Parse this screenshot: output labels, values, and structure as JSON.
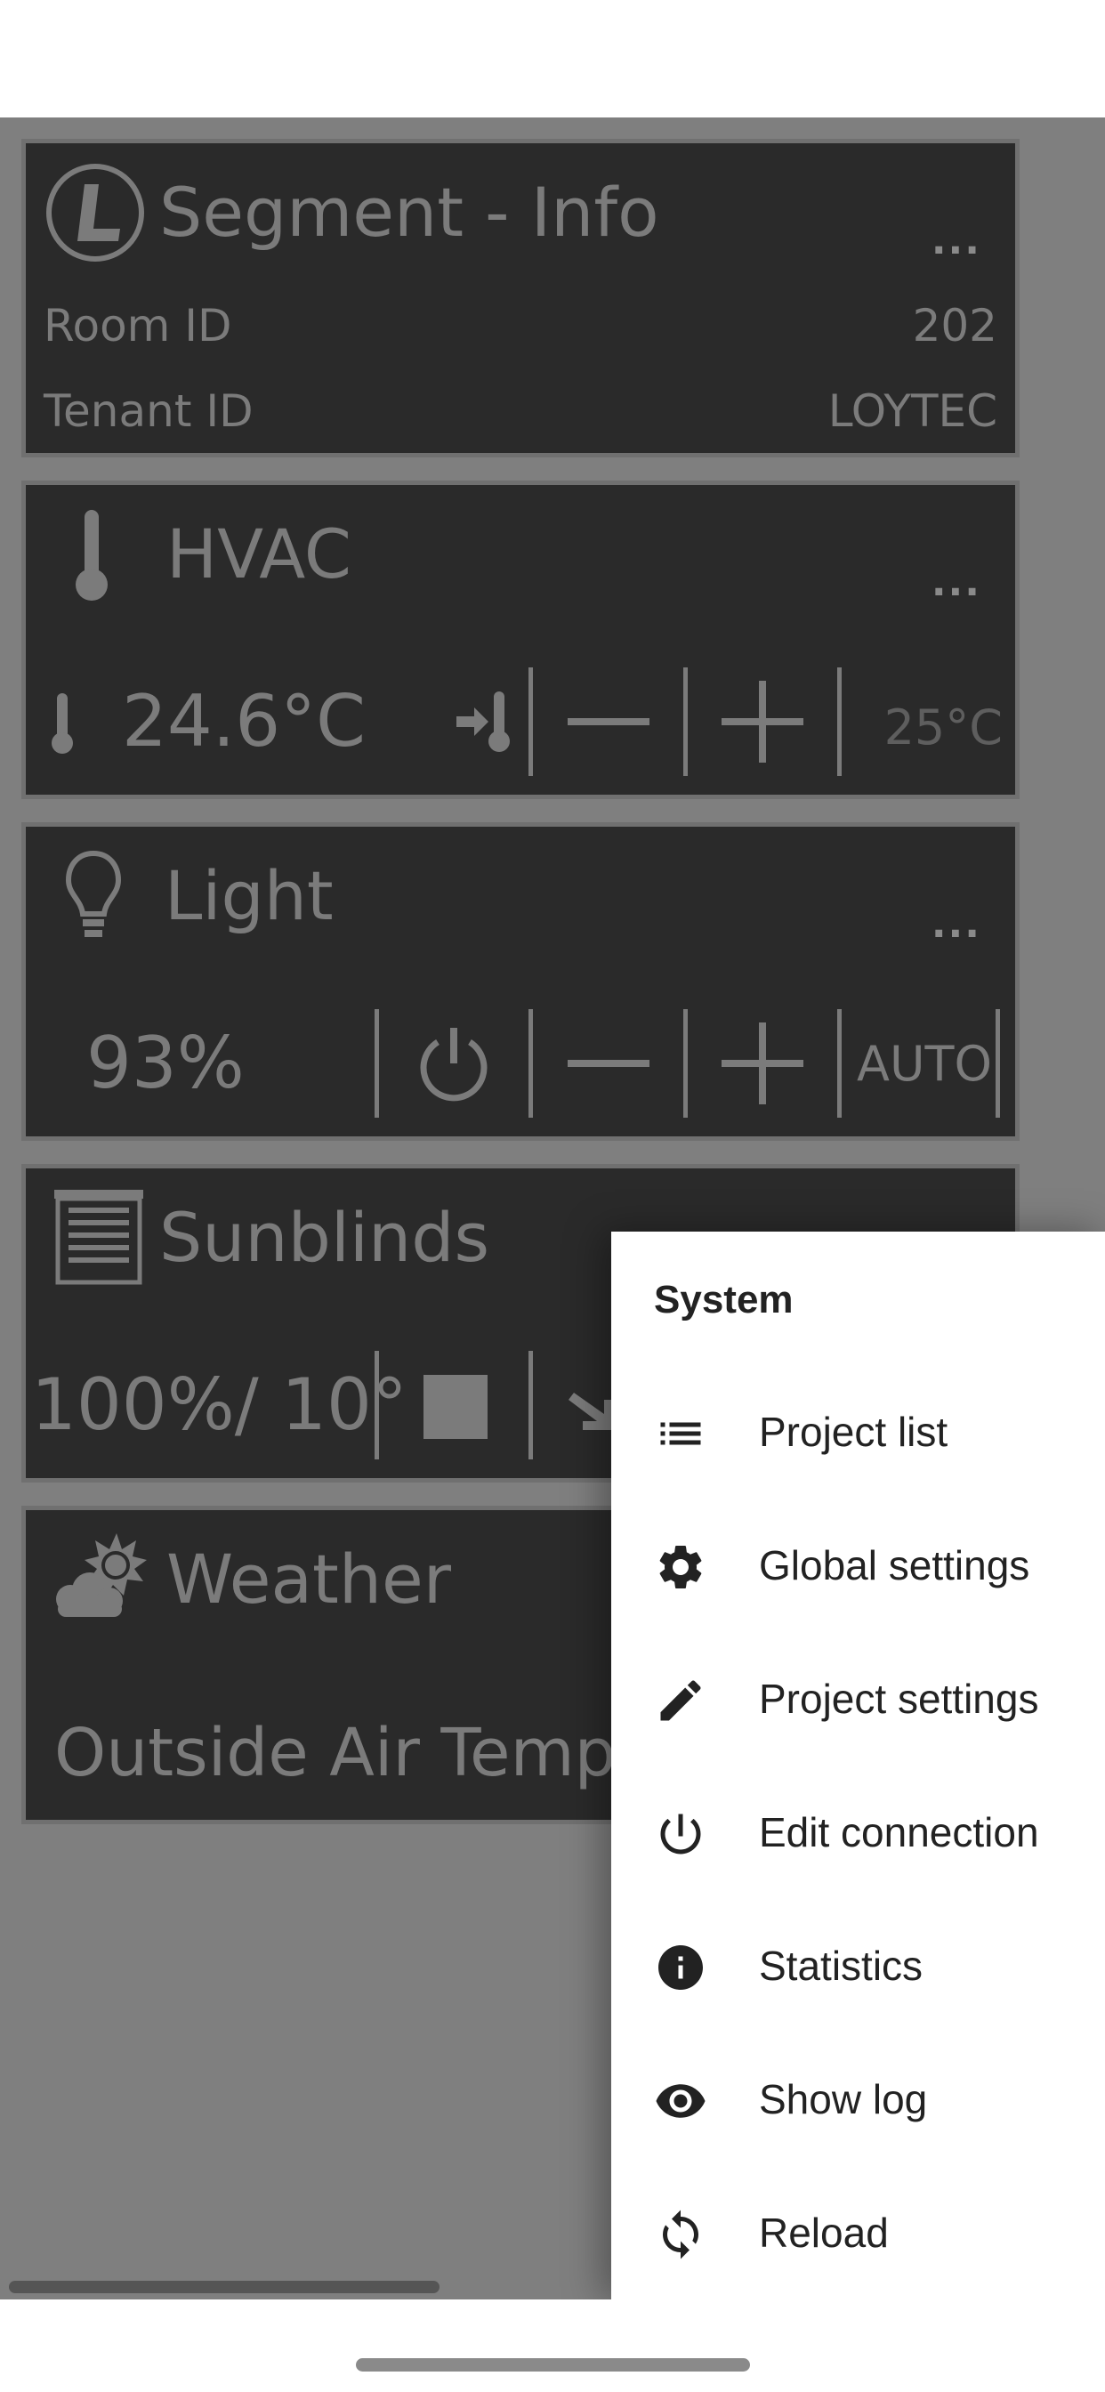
{
  "cards": {
    "segment": {
      "title": "Segment - Info",
      "more": "...",
      "rows": [
        {
          "label": "Room ID",
          "value": "202"
        },
        {
          "label": "Tenant ID",
          "value": "LOYTEC"
        }
      ]
    },
    "hvac": {
      "title": "HVAC",
      "more": "...",
      "current_temp": "24.6°C",
      "setpoint": "25°C"
    },
    "light": {
      "title": "Light",
      "more": "...",
      "level": "93%",
      "auto_label": "AUTO"
    },
    "sunblinds": {
      "title": "Sunblinds",
      "position": "100%/ 10°"
    },
    "weather": {
      "title": "Weather",
      "outside_label": "Outside Air Temp."
    }
  },
  "menu": {
    "title": "System",
    "items": [
      {
        "label": "Project list",
        "icon": "list-icon"
      },
      {
        "label": "Global settings",
        "icon": "gear-icon"
      },
      {
        "label": "Project settings",
        "icon": "pencil-icon"
      },
      {
        "label": "Edit connection",
        "icon": "power-icon"
      },
      {
        "label": "Statistics",
        "icon": "info-icon"
      },
      {
        "label": "Show log",
        "icon": "eye-icon"
      },
      {
        "label": "Reload",
        "icon": "reload-icon"
      }
    ]
  },
  "colors": {
    "card_bg": "#2a2a2a",
    "card_text": "#7b7b7b",
    "overlay": "#7f7f7f",
    "menu_bg": "#ffffff",
    "menu_text": "#222222"
  }
}
